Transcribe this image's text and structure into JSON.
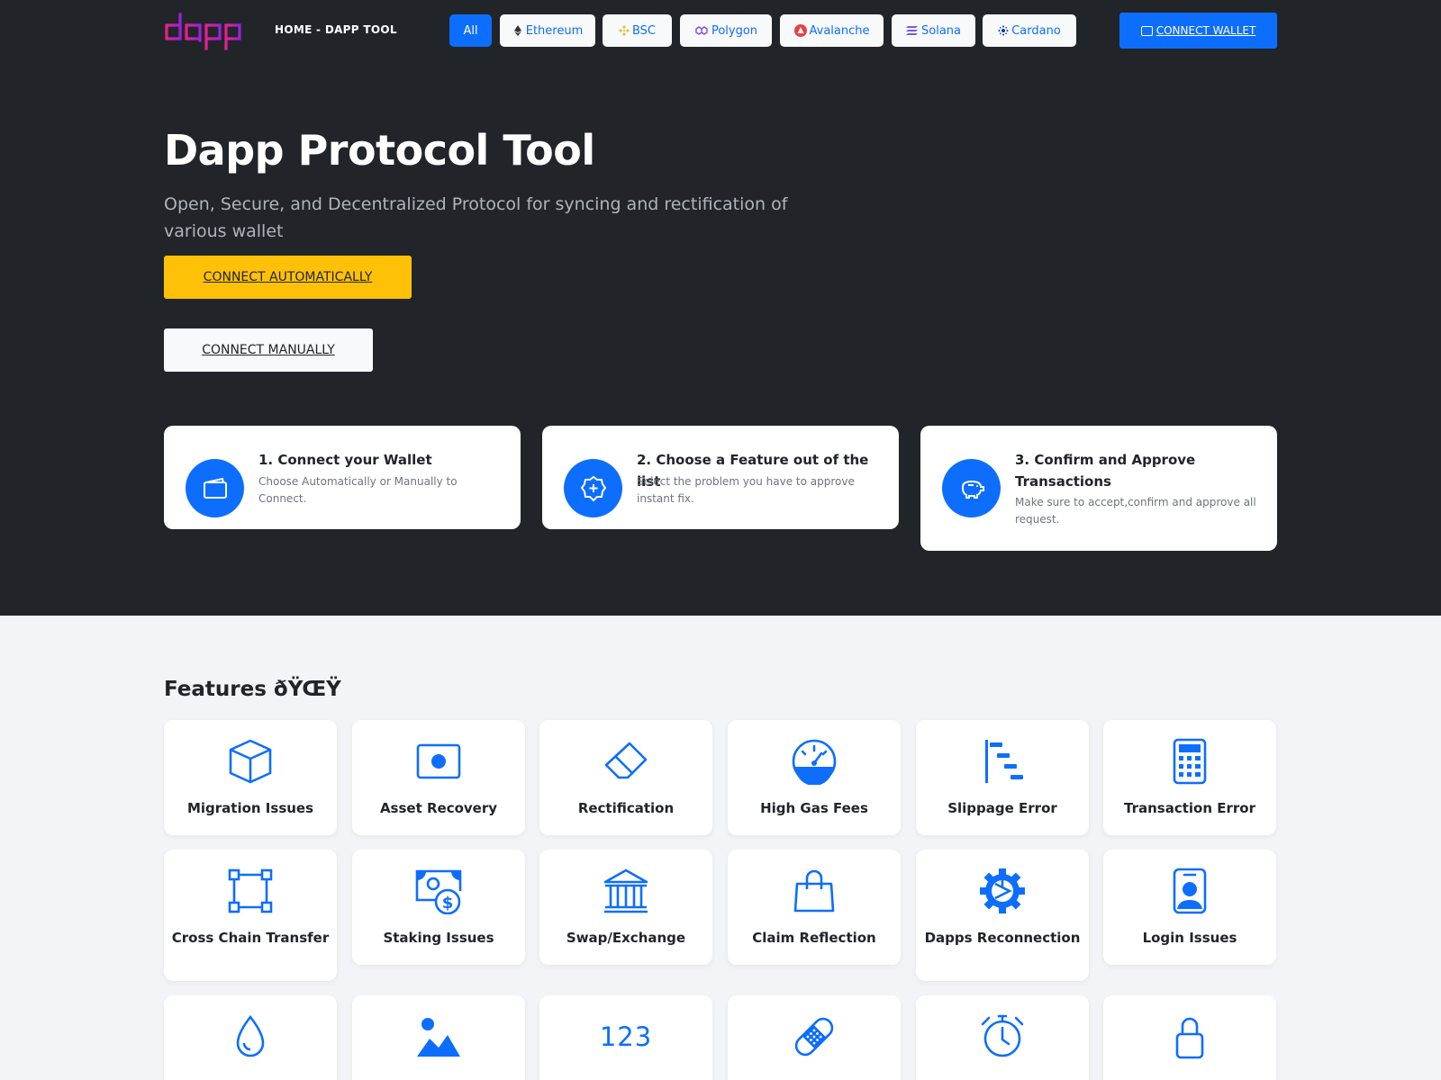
{
  "nav": {
    "home_label": "HOME - DAPP TOOL",
    "chains": [
      {
        "label": "All",
        "icon": "all"
      },
      {
        "label": "Ethereum",
        "icon": "ethereum-icon"
      },
      {
        "label": "BSC",
        "icon": "bsc-icon"
      },
      {
        "label": "Polygon",
        "icon": "polygon-icon"
      },
      {
        "label": "Avalanche",
        "icon": "avalanche-icon"
      },
      {
        "label": "Solana",
        "icon": "solana-icon"
      },
      {
        "label": "Cardano",
        "icon": "cardano-icon"
      }
    ],
    "active_chain": "All",
    "connect_wallet_label": "CONNECT WALLET"
  },
  "hero": {
    "title": "Dapp Protocol Tool",
    "subtitle": "Open, Secure, and Decentralized Protocol for syncing and rectification of various wallet",
    "connect_auto_label": "CONNECT AUTOMATICALLY",
    "connect_manual_label": "CONNECT MANUALLY"
  },
  "steps": [
    {
      "title": "1. Connect your Wallet",
      "desc": "Choose Automatically or Manually to Connect.",
      "icon": "wallet-icon"
    },
    {
      "title": "2. Choose a Feature out of the list",
      "desc": "Select the problem you have to approve instant fix.",
      "icon": "plus-badge-icon"
    },
    {
      "title": "3. Confirm and Approve Transactions",
      "desc": "Make sure to accept,confirm and approve all request.",
      "icon": "piggy-bank-icon"
    }
  ],
  "features": {
    "title": "Features ðŸŒŸ",
    "items": [
      {
        "label": "Migration Issues",
        "icon": "box-icon"
      },
      {
        "label": "Asset Recovery",
        "icon": "record-icon"
      },
      {
        "label": "Rectification",
        "icon": "eraser-icon"
      },
      {
        "label": "High Gas Fees",
        "icon": "speedometer-icon"
      },
      {
        "label": "Slippage Error",
        "icon": "bar-chart-steps-icon"
      },
      {
        "label": "Transaction Error",
        "icon": "calculator-icon"
      },
      {
        "label": "Cross Chain Transfer",
        "icon": "bounding-box-icon"
      },
      {
        "label": "Staking Issues",
        "icon": "cash-coin-icon"
      },
      {
        "label": "Swap/Exchange",
        "icon": "bank-icon"
      },
      {
        "label": "Claim Reflection",
        "icon": "bag-icon"
      },
      {
        "label": "Dapps Reconnection",
        "icon": "gear-icon"
      },
      {
        "label": "Login Issues",
        "icon": "person-badge-icon"
      },
      {
        "label": "",
        "icon": "droplet-icon"
      },
      {
        "label": "",
        "icon": "image-icon"
      },
      {
        "label": "",
        "icon": "number-icon",
        "icon_text": "123"
      },
      {
        "label": "",
        "icon": "bandage-icon"
      },
      {
        "label": "",
        "icon": "alarm-icon"
      },
      {
        "label": "",
        "icon": "lock-icon"
      }
    ]
  },
  "colors": {
    "dark_bg": "#212529",
    "accent": "#0d6efd",
    "warning": "#ffc107",
    "light_bg": "#f3f4f7"
  }
}
